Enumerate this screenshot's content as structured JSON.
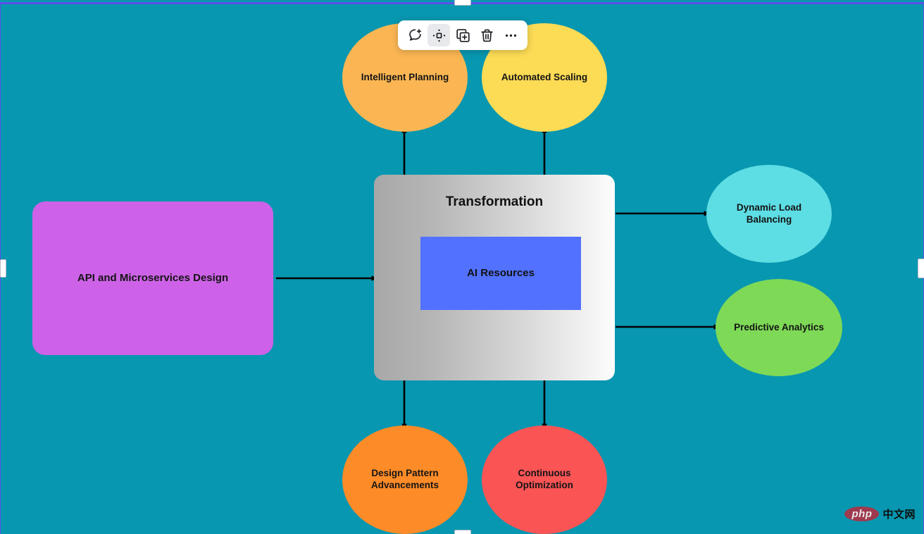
{
  "canvas": {
    "background_color": "#0897b0",
    "selection_border_color": "#5b4fe8"
  },
  "toolbar": {
    "items": [
      {
        "name": "add-comment",
        "label": "Add comment",
        "icon": "comment-plus-icon",
        "active": false
      },
      {
        "name": "move",
        "label": "Move",
        "icon": "move-icon",
        "active": true
      },
      {
        "name": "duplicate",
        "label": "Duplicate",
        "icon": "duplicate-icon",
        "active": false
      },
      {
        "name": "delete",
        "label": "Delete",
        "icon": "trash-icon",
        "active": false
      },
      {
        "name": "more",
        "label": "More options",
        "icon": "ellipsis-icon",
        "active": false
      }
    ]
  },
  "diagram": {
    "type": "flowchart",
    "nodes": [
      {
        "id": "api",
        "label": "API and Microservices Design",
        "shape": "rounded-rect",
        "color": "#cd62e8"
      },
      {
        "id": "container",
        "label": "Transformation",
        "shape": "rounded-rect",
        "color": "#c9c9c9"
      },
      {
        "id": "ai_resources",
        "label": "AI Resources",
        "shape": "rect",
        "color": "#5271ff"
      },
      {
        "id": "planning",
        "label": "Intelligent Planning",
        "shape": "ellipse",
        "color": "#fbb653"
      },
      {
        "id": "scaling",
        "label": "Automated Scaling",
        "shape": "ellipse",
        "color": "#fcdb55"
      },
      {
        "id": "load_balancing",
        "label": "Dynamic Load\nBalancing",
        "shape": "ellipse",
        "color": "#5ddde4"
      },
      {
        "id": "predictive",
        "label": "Predictive Analytics",
        "shape": "ellipse",
        "color": "#7ed957"
      },
      {
        "id": "design_pattern",
        "label": "Design Pattern\nAdvancements",
        "shape": "ellipse",
        "color": "#fc8b28"
      },
      {
        "id": "continuous",
        "label": "Continuous\nOptimization",
        "shape": "ellipse",
        "color": "#fa5455"
      }
    ],
    "edges": [
      {
        "from": "api",
        "to": "container",
        "direction": "right"
      },
      {
        "from": "container",
        "to": "planning",
        "direction": "up"
      },
      {
        "from": "container",
        "to": "scaling",
        "direction": "up"
      },
      {
        "from": "container",
        "to": "load_balancing",
        "direction": "right"
      },
      {
        "from": "container",
        "to": "predictive",
        "direction": "right"
      },
      {
        "from": "container",
        "to": "design_pattern",
        "direction": "down"
      },
      {
        "from": "container",
        "to": "continuous",
        "direction": "down"
      }
    ]
  },
  "watermark": {
    "logo_text": "php",
    "site_text": "中文网"
  }
}
